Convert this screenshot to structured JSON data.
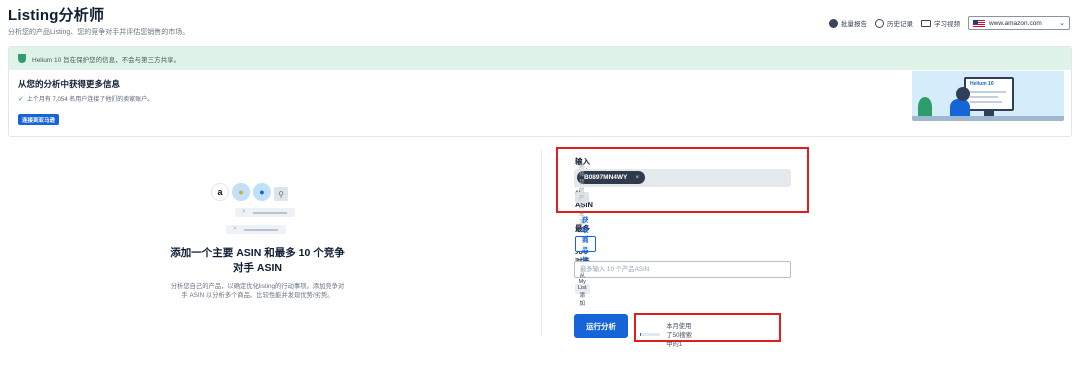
{
  "header": {
    "title": "Listing分析师",
    "subtitle": "分析您的产品Listing、您的竞争对手并评估您销售的市场。"
  },
  "top_actions": {
    "batch_report": "批量报告",
    "history": "历史记录",
    "tutorial_video": "学习视频",
    "marketplace": "www.amazon.com"
  },
  "banner": {
    "privacy_notice": "Helium 10 旨在保护您的信息，不会与第三方共享。",
    "heading": "从您的分析中获得更多信息",
    "note": "上个月有 7,054 名用户连接了他们的卖家账户。",
    "connect_button": "连接到亚马逊",
    "illustration_logo": "Helium 10"
  },
  "left_panel": {
    "amazon_glyph": "a",
    "heading": "添加一个主要 ASIN 和最多 10 个竞争对手 ASIN",
    "description": "分析您自己的产品，以确定优化listing的行动事项。添加竞争对手 ASIN 以分析多个商品、比较性能并发现优势/劣势。",
    "remove_glyph": "×"
  },
  "main_asin": {
    "label": "输入一个主要的ASIN",
    "chip_value": "B0897MN4WY",
    "chip_remove": "×",
    "select_button": "选择我的产品来添加"
  },
  "competitors": {
    "label": "最多10个竞争对手 ASIN",
    "fetch_button": "获取商品信息",
    "input_placeholder": "最多输入 10 个产品ASIN",
    "from_list_button": "从My List添加"
  },
  "run": {
    "button": "运行分析",
    "usage_text": "本月使用了50搜索中的1",
    "usage_used": 1,
    "usage_total": 50
  },
  "colors": {
    "accent": "#1565d8",
    "success": "#2e9d6b",
    "highlight_box": "#e01e1e"
  }
}
